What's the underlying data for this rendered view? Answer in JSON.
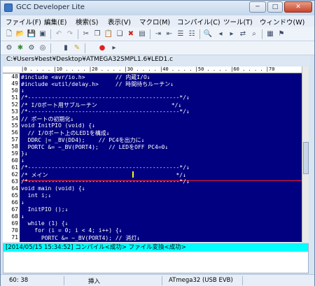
{
  "window": {
    "title": "GCC Developer Lite",
    "minimize": "─",
    "maximize": "□",
    "close": "✕"
  },
  "menu": [
    "ファイル(F)",
    "編集(E)",
    "検索(S)",
    "表示(V)",
    "マクロ(M)",
    "コンパイル(C)",
    "ツール(T)",
    "ウィンドウ(W)"
  ],
  "file_path": "C:¥Users¥best¥Desktop¥ATMEGA32SMPL1.6¥LED1.c",
  "ruler": "|0 . . . . |10 . . . . |20 . . . . |30 . . . . |40 . . . . |50 . . . . |60 . . . . |70",
  "editor": {
    "line_numbers": [
      "48",
      "49",
      "50",
      "51",
      "52",
      "53",
      "54",
      "55",
      "56",
      "57",
      "58",
      "59",
      "60",
      "61",
      "62",
      "63",
      "64",
      "65",
      "66",
      "67",
      "68",
      "69",
      "70",
      "71"
    ],
    "lines": [
      "#include <avr/io.h>         // 内蔵I/O↓",
      "#include <util/delay.h>     // 時間待ちルーチン↓",
      "↓",
      "/*---------------------------------------------*/↓",
      "/* I/Oポート用サブルーチン                      */↓",
      "/*---------------------------------------------*/↓",
      "// ポートの初期化↓",
      "void InitPIO (void) {↓",
      "  // I/Oポート上のLED1を構成↓",
      "  DDRC |= _BV(DD4);    // PC4を出力に↓",
      "  PORTC &= ~_BV(PORT4);   // LEDをOFF PC4=0↓",
      "}↓",
      "↓",
      "/*---------------------------------------------*/↓",
      "/* メイン                                      */↓",
      "/*---------------------------------------------*/↓",
      "void main (void) {↓",
      "  int i;↓",
      "↓",
      "  InitPIO ();↓",
      "↓",
      "  while (1) {↓",
      "    for (i = 0; i < 4; i++) {↓",
      "      PORTC &= ~_BV(PORT4); // 消灯↓"
    ]
  },
  "output": {
    "message": "[2014/05/15 15:34:52] コンパイル<成功> ファイル変換<成功>"
  },
  "status": {
    "position": "60: 38",
    "mode": "挿入",
    "device": "ATmega32 (USB EVB)"
  }
}
